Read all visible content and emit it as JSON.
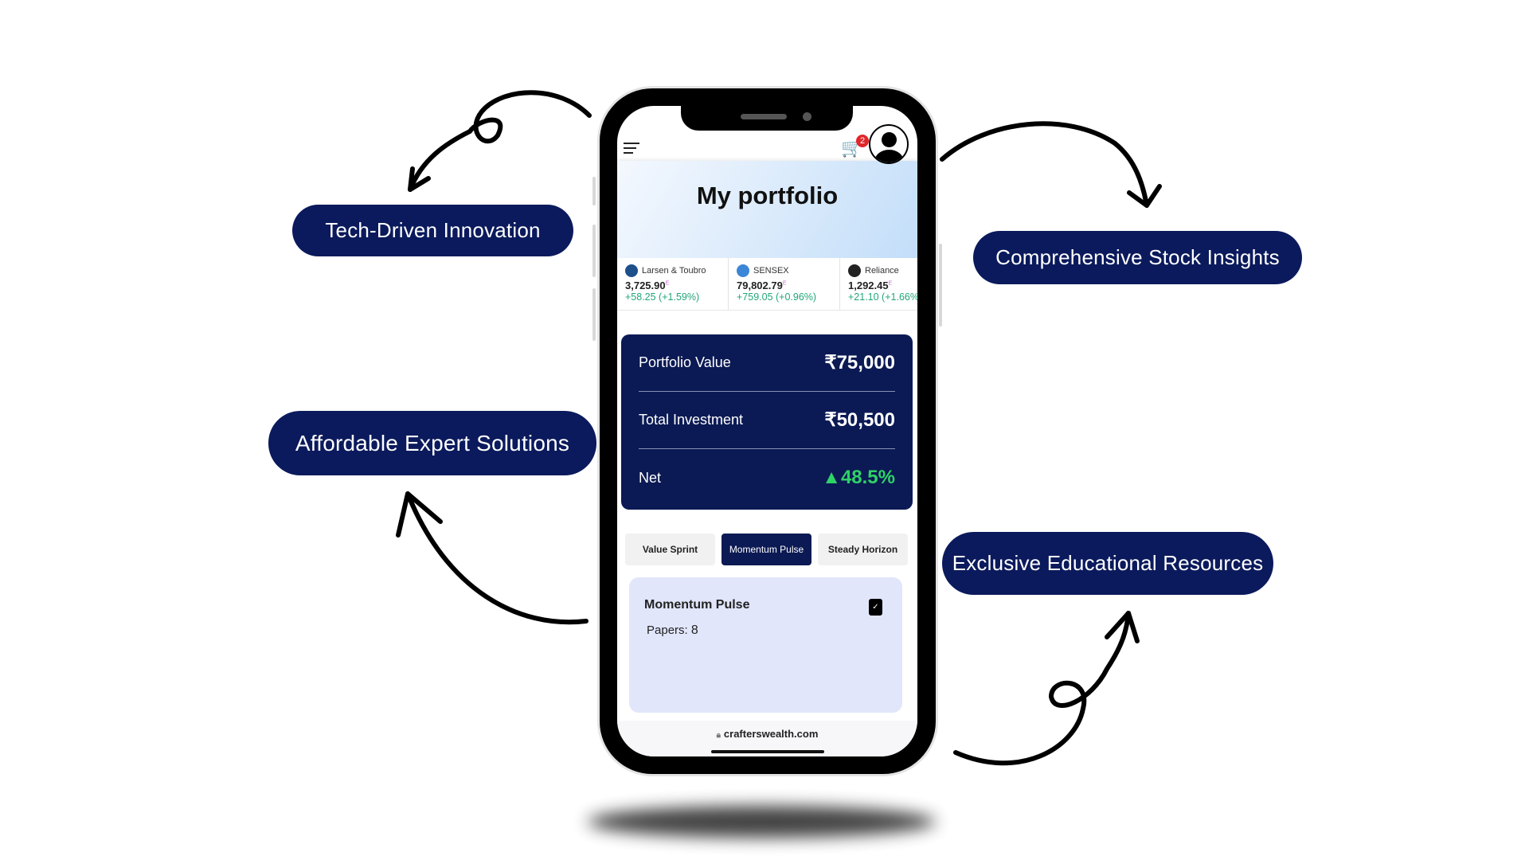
{
  "features": [
    {
      "label": "Tech-Driven Innovation"
    },
    {
      "label": "Comprehensive Stock Insights"
    },
    {
      "label": "Affordable Expert Solutions"
    },
    {
      "label": "Exclusive Educational Resources"
    }
  ],
  "header": {
    "menu_icon": "hamburger-icon",
    "cart_icon": "cart-icon",
    "cart_count": "2",
    "avatar_icon": "user-avatar-icon"
  },
  "banner": {
    "title": "My portfolio"
  },
  "ticker": [
    {
      "name": "Larsen & Toubro",
      "price": "3,725.90",
      "flag": "E",
      "change": "+58.25 (+1.59%)",
      "color": "#1d4f8a"
    },
    {
      "name": "SENSEX",
      "price": "79,802.79",
      "flag": "E",
      "change": "+759.05 (+0.96%)",
      "color": "#3b86d6"
    },
    {
      "name": "Reliance",
      "price": "1,292.45",
      "flag": "E",
      "change": "+21.10 (+1.66%)",
      "color": "#222"
    }
  ],
  "summary": [
    {
      "label": "Portfolio Value",
      "value": "₹75,000"
    },
    {
      "label": "Total Investment",
      "value": "₹50,500"
    },
    {
      "label": "Net",
      "value": "▲48.5%"
    }
  ],
  "tabs": [
    {
      "label": "Value Sprint"
    },
    {
      "label": "Momentum Pulse"
    },
    {
      "label": "Steady Horizon"
    }
  ],
  "plan": {
    "title": "Momentum Pulse",
    "papers_label": "Papers:",
    "papers_value": "8"
  },
  "browser": {
    "url": "crafterswealth.com"
  },
  "colors": {
    "navy": "#0b1a5c",
    "positive": "#2ed267"
  }
}
